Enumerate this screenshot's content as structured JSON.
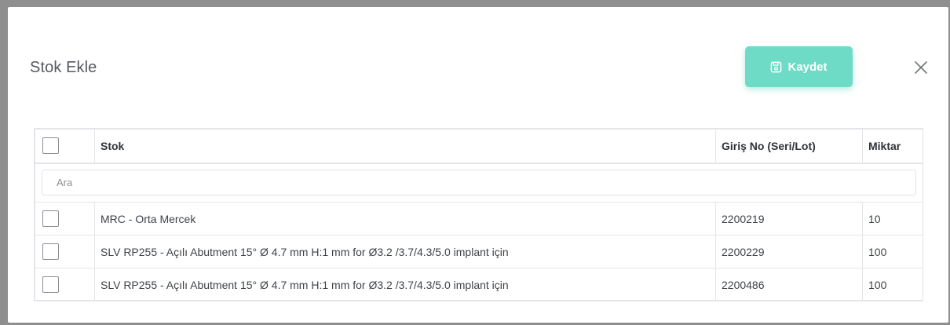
{
  "modal": {
    "title": "Stok Ekle",
    "save_label": "Kaydet",
    "colors": {
      "accent": "#6ddbc6",
      "backdrop": "#8f8f8f"
    },
    "icons": {
      "save": "save-icon",
      "close": "close-icon"
    }
  },
  "table": {
    "columns": [
      "Stok",
      "Giriş No (Seri/Lot)",
      "Miktar"
    ],
    "search_placeholder": "Ara",
    "rows": [
      {
        "stok": "MRC - Orta Mercek",
        "lot": "2200219",
        "qty": "10"
      },
      {
        "stok": "SLV RP255 - Açılı Abutment 15° Ø 4.7 mm H:1 mm for Ø3.2 /3.7/4.3/5.0 implant için",
        "lot": "2200229",
        "qty": "100"
      },
      {
        "stok": "SLV RP255 - Açılı Abutment 15° Ø 4.7 mm H:1 mm for Ø3.2 /3.7/4.3/5.0 implant için",
        "lot": "2200486",
        "qty": "100"
      }
    ]
  }
}
